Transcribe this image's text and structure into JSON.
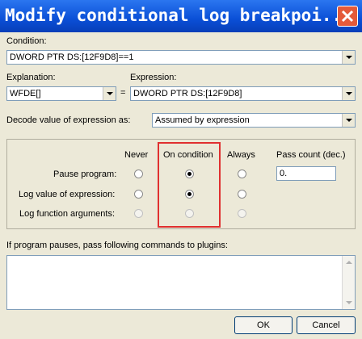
{
  "window": {
    "title": "Modify conditional log breakpoi..."
  },
  "condition": {
    "label": "Condition:",
    "value": "DWORD PTR DS:[12F9D8]==1"
  },
  "explanation": {
    "label": "Explanation:",
    "value": "WFDE[]"
  },
  "equals_sign": "=",
  "expression": {
    "label": "Expression:",
    "value": "DWORD PTR DS:[12F9D8]"
  },
  "decode": {
    "label": "Decode value of expression as:",
    "value": "Assumed by expression"
  },
  "options": {
    "columns": [
      "Never",
      "On condition",
      "Always"
    ],
    "pass_count_label": "Pass count (dec.)",
    "pass_count_value": "0.",
    "rows": [
      {
        "label": "Pause program:",
        "selected": "On condition"
      },
      {
        "label": "Log value of expression:",
        "selected": "On condition"
      },
      {
        "label": "Log function arguments:",
        "selected": "none",
        "disabled": true
      }
    ]
  },
  "plugins": {
    "label": "If program pauses, pass following commands to plugins:",
    "value": ""
  },
  "buttons": {
    "ok": "OK",
    "cancel": "Cancel"
  },
  "colors": {
    "title_bar": "#0a58e0",
    "highlight_box": "#e03030",
    "dialog_bg": "#ece9d8"
  }
}
